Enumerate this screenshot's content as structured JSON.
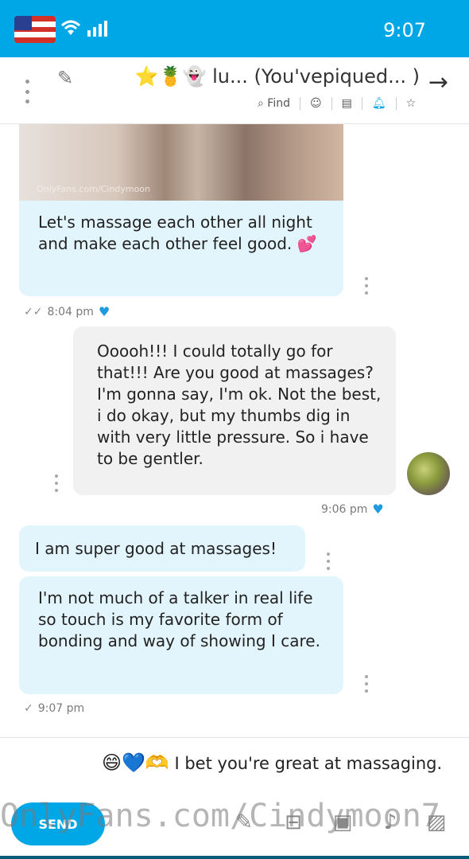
{
  "status_bar": {
    "time": "9:07",
    "signal_icon": "signal-icon",
    "wifi_icon": "wifi-icon",
    "flag_icon": "us-flag-icon",
    "color": "#00a7e6"
  },
  "header": {
    "title": "⭐🍍👻 lu... (You'vepiqued... )",
    "find_label": "Find",
    "back_icon": "arrow-icon",
    "edit_icon": "pencil-icon",
    "menu_icon": "kebab-icon"
  },
  "messages": [
    {
      "id": "m1",
      "side": "theirs",
      "text": "Let's massage each other all night and make each other feel good. 💕",
      "time": "8:04 pm",
      "watermark": "OnlyFans.com/Cindymoon"
    },
    {
      "id": "m2",
      "side": "mine",
      "text": "Ooooh!!! I could totally go for that!!! Are you good at massages? I'm gonna say, I'm ok. Not the best, i do okay, but my thumbs dig in with very little pressure. So i have to be gentler.",
      "time": "9:06 pm"
    },
    {
      "id": "m3",
      "side": "theirs",
      "text": "I am super good at massages!"
    },
    {
      "id": "m4",
      "side": "theirs",
      "text": "I'm not much of a talker in real life so touch is my favorite form of bonding and way of showing I care.",
      "time": "9:07 pm"
    }
  ],
  "composer": {
    "text": "I bet you're great at massaging.",
    "emojis": "😄💙🫶",
    "send_label": "SEND",
    "watermark": "OnlyFans.com/Cindymoon7"
  },
  "colors": {
    "accent": "#00a7e6",
    "bubble_theirs": "#e3f5fc",
    "bubble_mine": "#f1f1f1"
  }
}
